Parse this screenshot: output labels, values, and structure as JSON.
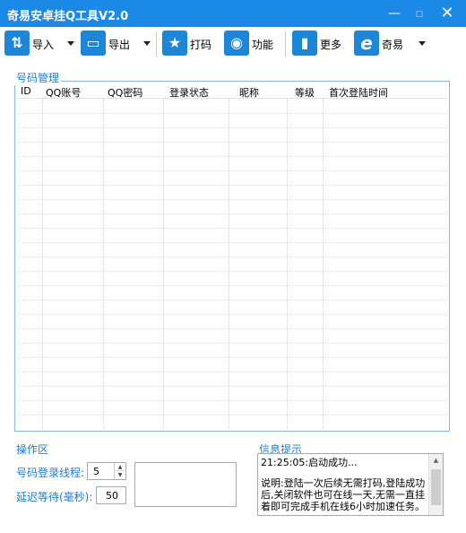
{
  "window": {
    "title": "奇易安卓挂Q工具V2.0",
    "min_glyph": "—",
    "max_glyph": "▫",
    "close_glyph": "✕"
  },
  "toolbar": {
    "items": [
      {
        "label": "导入",
        "icon_glyph": "⇅",
        "icon_name": "import-icon"
      },
      {
        "label": "导出",
        "icon_glyph": "▭",
        "icon_name": "export-icon"
      },
      {
        "label": "打码",
        "icon_glyph": "★",
        "icon_name": "star-icon"
      },
      {
        "label": "功能",
        "icon_glyph": "◉",
        "icon_name": "function-icon"
      },
      {
        "label": "更多",
        "icon_glyph": "▮",
        "icon_name": "bar-chart-icon"
      },
      {
        "label": "奇易",
        "icon_glyph": "e",
        "icon_name": "browser-icon"
      }
    ],
    "accent_color": "#1c87d8"
  },
  "number_panel": {
    "title": "号码管理",
    "columns": [
      "ID",
      "QQ账号",
      "QQ密码",
      "登录状态",
      "昵称",
      "等级",
      "首次登陆时间"
    ]
  },
  "operation_panel": {
    "title": "操作区",
    "threads_label": "号码登录线程:",
    "threads_value": "5",
    "delay_label": "延迟等待(毫秒):",
    "delay_value": "50"
  },
  "info_panel": {
    "title": "信息提示",
    "log_line": "21:25:05:启动成功...",
    "description": "说明:登陆一次后续无需打码,登陆成功后,关闭软件也可在线一天,无需一直挂着即可完成手机在线6小时加速任务。"
  },
  "colors": {
    "titlebar": "#1a8ae6",
    "group_label": "#1a7fd0",
    "group_border": "#8bb8e0"
  }
}
